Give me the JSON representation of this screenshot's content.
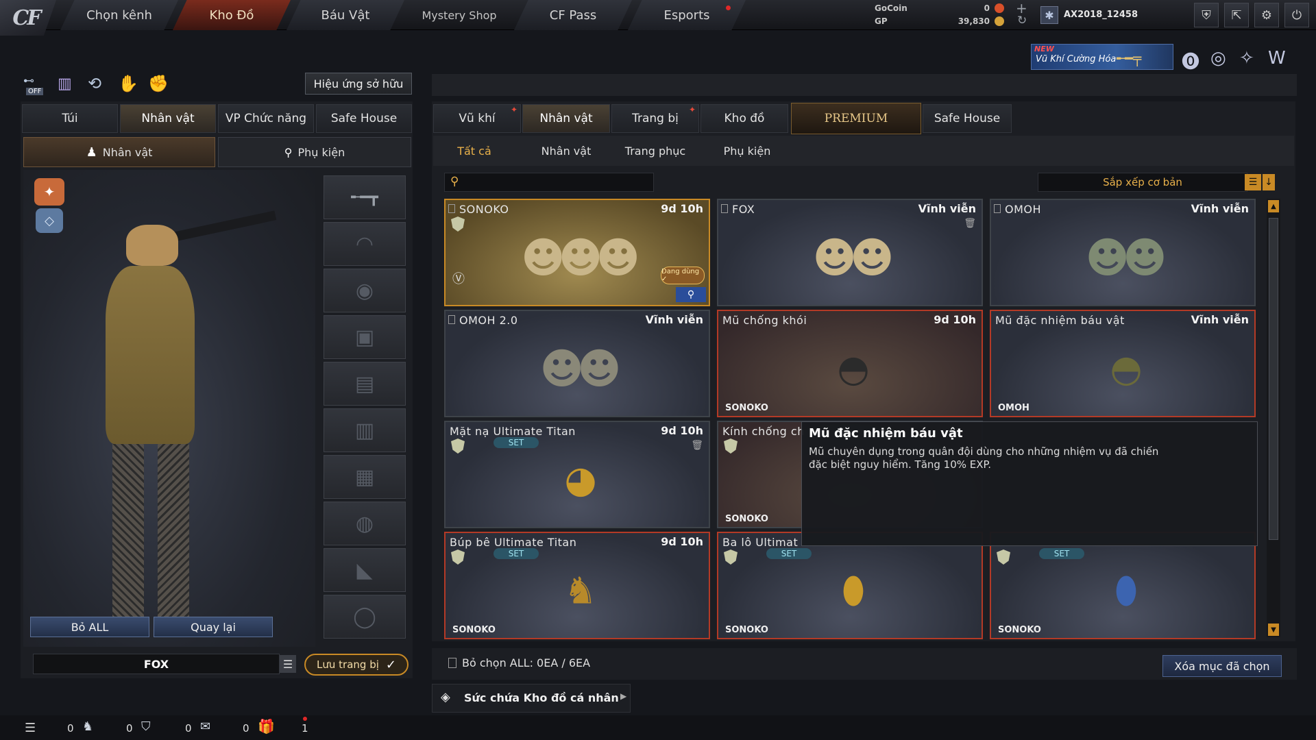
{
  "app": {
    "logo": "CF"
  },
  "nav": {
    "tabs": [
      {
        "label": "Chọn kênh"
      },
      {
        "label": "Kho Đồ"
      },
      {
        "label": "Báu Vật"
      },
      {
        "label": "Mystery Shop"
      },
      {
        "label": "CF Pass"
      },
      {
        "label": "Esports"
      }
    ],
    "active": "Kho Đồ"
  },
  "currency": {
    "gocoin_label": "GoCoin",
    "gocoin_value": "0",
    "gp_label": "GP",
    "gp_value": "39,830"
  },
  "user": {
    "name": "AX2018_12458"
  },
  "banner": {
    "new": "NEW",
    "text": "Vũ Khí Cường Hóa"
  },
  "left": {
    "effect_button": "Hiệu ứng sở hữu",
    "off_label": "OFF",
    "tabs": [
      "Túi",
      "Nhân vật",
      "VP Chức năng",
      "Safe House"
    ],
    "subtabs": [
      "Nhân vật",
      "Phụ kiện"
    ],
    "btn_remove_all": "Bỏ ALL",
    "btn_back": "Quay lại",
    "character_name": "FOX",
    "save_label": "Lưu trang bị"
  },
  "right": {
    "tabs": [
      "Vũ khí",
      "Nhân vật",
      "Trang bị",
      "Kho đồ",
      "PREMIUM",
      "Safe House"
    ],
    "subtabs": [
      "Tất cả",
      "Nhân vật",
      "Trang phục",
      "Phụ kiện"
    ],
    "search_placeholder": "",
    "sort_label": "Sắp xếp cơ bản",
    "in_use_label": "Đang dùng",
    "set_label": "SET",
    "cards": [
      {
        "name": "SONOKO",
        "time": "9d 10h",
        "owner": ""
      },
      {
        "name": "FOX",
        "time": "Vĩnh viễn",
        "owner": ""
      },
      {
        "name": "OMOH",
        "time": "Vĩnh viễn",
        "owner": ""
      },
      {
        "name": "OMOH 2.0",
        "time": "Vĩnh viễn",
        "owner": ""
      },
      {
        "name": "Mũ chống khói",
        "time": "9d 10h",
        "owner": "SONOKO"
      },
      {
        "name": "Mũ đặc nhiệm báu vật",
        "time": "Vĩnh viễn",
        "owner": "OMOH"
      },
      {
        "name": "Mặt nạ Ultimate Titan",
        "time": "9d 10h",
        "owner": ""
      },
      {
        "name": "Kính chống ch",
        "time": "",
        "owner": "SONOKO"
      },
      {
        "name": "",
        "time": "",
        "owner": ""
      },
      {
        "name": "Búp bê Ultimate Titan",
        "time": "9d 10h",
        "owner": "SONOKO"
      },
      {
        "name": "Ba lô Ultimat",
        "time": "",
        "owner": "SONOKO"
      },
      {
        "name": "",
        "time": "",
        "owner": "SONOKO"
      }
    ],
    "tooltip": {
      "title": "Mũ đặc nhiệm báu vật",
      "desc": "Mũ chuyên dụng trong quân đội dùng cho những nhiệm vụ đã chiến đặc biệt nguy hiểm. Tăng 10% EXP."
    },
    "deselect": "Bỏ chọn ALL: 0EA / 6EA",
    "delete_selected": "Xóa mục đã chọn",
    "capacity": "Sức chứa Kho đồ cá nhân"
  },
  "bottom": {
    "counts": [
      "0",
      "0",
      "0",
      "0",
      "1"
    ]
  },
  "colors": {
    "accent": "#c98a25",
    "danger": "#b43a26",
    "bg": "#15171c"
  }
}
